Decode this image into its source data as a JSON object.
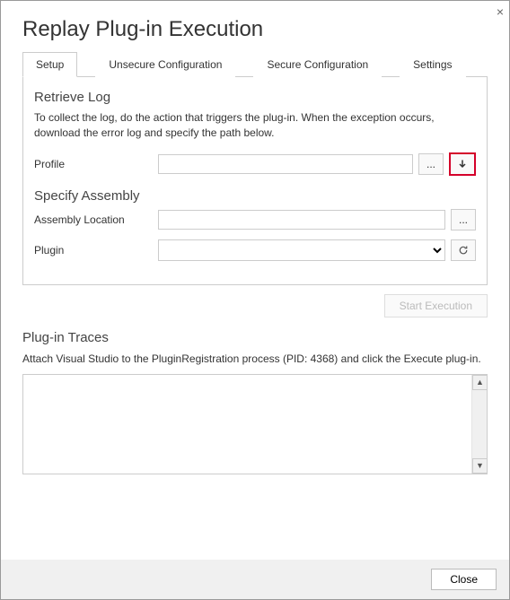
{
  "window": {
    "title": "Replay Plug-in Execution"
  },
  "tabs": {
    "setup": "Setup",
    "unsecure": "Unsecure Configuration",
    "secure": "Secure Configuration",
    "settings": "Settings"
  },
  "retrieve": {
    "header": "Retrieve Log",
    "desc": "To collect the log, do the action that triggers the plug-in. When the exception occurs, download the error log and specify the path below.",
    "profile_label": "Profile",
    "profile_value": "",
    "browse_label": "...",
    "download_label": "↓"
  },
  "assembly": {
    "header": "Specify Assembly",
    "location_label": "Assembly Location",
    "location_value": "",
    "browse_label": "...",
    "plugin_label": "Plugin",
    "plugin_value": ""
  },
  "actions": {
    "start": "Start Execution"
  },
  "traces": {
    "header": "Plug-in Traces",
    "desc": "Attach Visual Studio to the PluginRegistration process (PID: 4368) and click the Execute plug-in.",
    "content": ""
  },
  "footer": {
    "close": "Close"
  }
}
